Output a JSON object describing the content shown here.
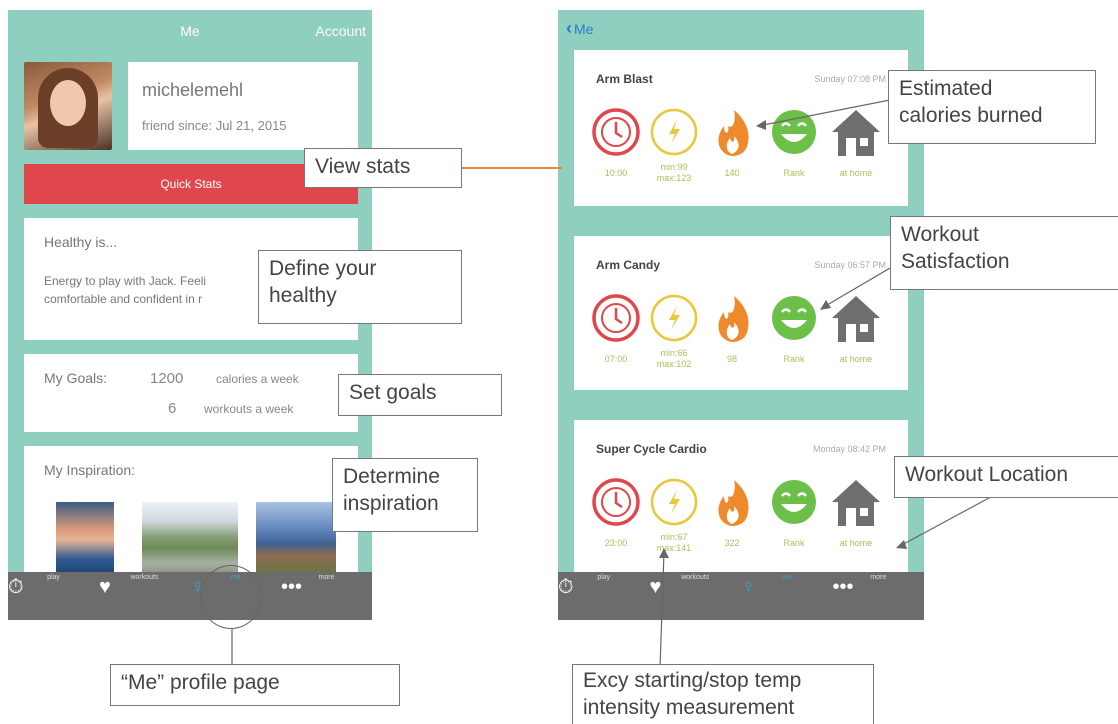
{
  "left_screen": {
    "header": {
      "title": "Me",
      "account": "Account"
    },
    "profile": {
      "username": "michelemehl",
      "friend_since": "friend since: Jul 21, 2015"
    },
    "quick_stats_label": "Quick Stats",
    "healthy": {
      "heading": "Healthy is...",
      "text_line1": "Energy to play with Jack. Feeli",
      "text_line2": "comfortable and confident in r"
    },
    "goals": {
      "heading": "My Goals:",
      "calories_value": "1200",
      "calories_unit": "calories a week",
      "workouts_value": "6",
      "workouts_unit": "workouts a week"
    },
    "inspiration": {
      "heading": "My Inspiration:"
    },
    "tabs": [
      {
        "icon": "stopwatch-icon",
        "label": "play"
      },
      {
        "icon": "heart-pulse-icon",
        "label": "workouts"
      },
      {
        "icon": "person-icon",
        "label": "me"
      },
      {
        "icon": "more-dots-icon",
        "label": "more"
      }
    ]
  },
  "right_screen": {
    "header": {
      "back_label": "Me"
    },
    "workouts": [
      {
        "title": "Arm Blast",
        "date": "Sunday 07:08 PM",
        "time": "10:00",
        "intensity_min": "min:99",
        "intensity_max": "max:123",
        "calories": "140",
        "rank": "Rank",
        "location": "at home"
      },
      {
        "title": "Arm Candy",
        "date": "Sunday 06:57 PM",
        "time": "07:00",
        "intensity_min": "min:66",
        "intensity_max": "max:102",
        "calories": "98",
        "rank": "Rank",
        "location": "at home"
      },
      {
        "title": "Super Cycle Cardio",
        "date": "Monday 08:42 PM",
        "time": "23:00",
        "intensity_min": "min:67",
        "intensity_max": "max:141",
        "calories": "322",
        "rank": "Rank",
        "location": "at home"
      }
    ],
    "tabs": [
      {
        "icon": "stopwatch-icon",
        "label": "play"
      },
      {
        "icon": "heart-pulse-icon",
        "label": "workouts"
      },
      {
        "icon": "person-icon",
        "label": "me"
      },
      {
        "icon": "more-dots-icon",
        "label": "more"
      }
    ]
  },
  "callouts": {
    "view_stats": "View stats",
    "define_healthy_1": "Define your",
    "define_healthy_2": "healthy",
    "set_goals": "Set goals",
    "determine_1": "Determine",
    "determine_2": "inspiration",
    "me_profile": "“Me” profile page",
    "calories_1": "Estimated",
    "calories_2": "calories burned",
    "satisfaction_1": "Workout",
    "satisfaction_2": "Satisfaction",
    "location": "Workout Location",
    "intensity_1": "Excy starting/stop temp",
    "intensity_2": "intensity measurement"
  },
  "colors": {
    "teal": "#8ecfc0",
    "red": "#e0474c",
    "yellow": "#e8c83a",
    "orange": "#ef8a2c",
    "green": "#6cc04a",
    "house_gray": "#6f6f6f"
  }
}
